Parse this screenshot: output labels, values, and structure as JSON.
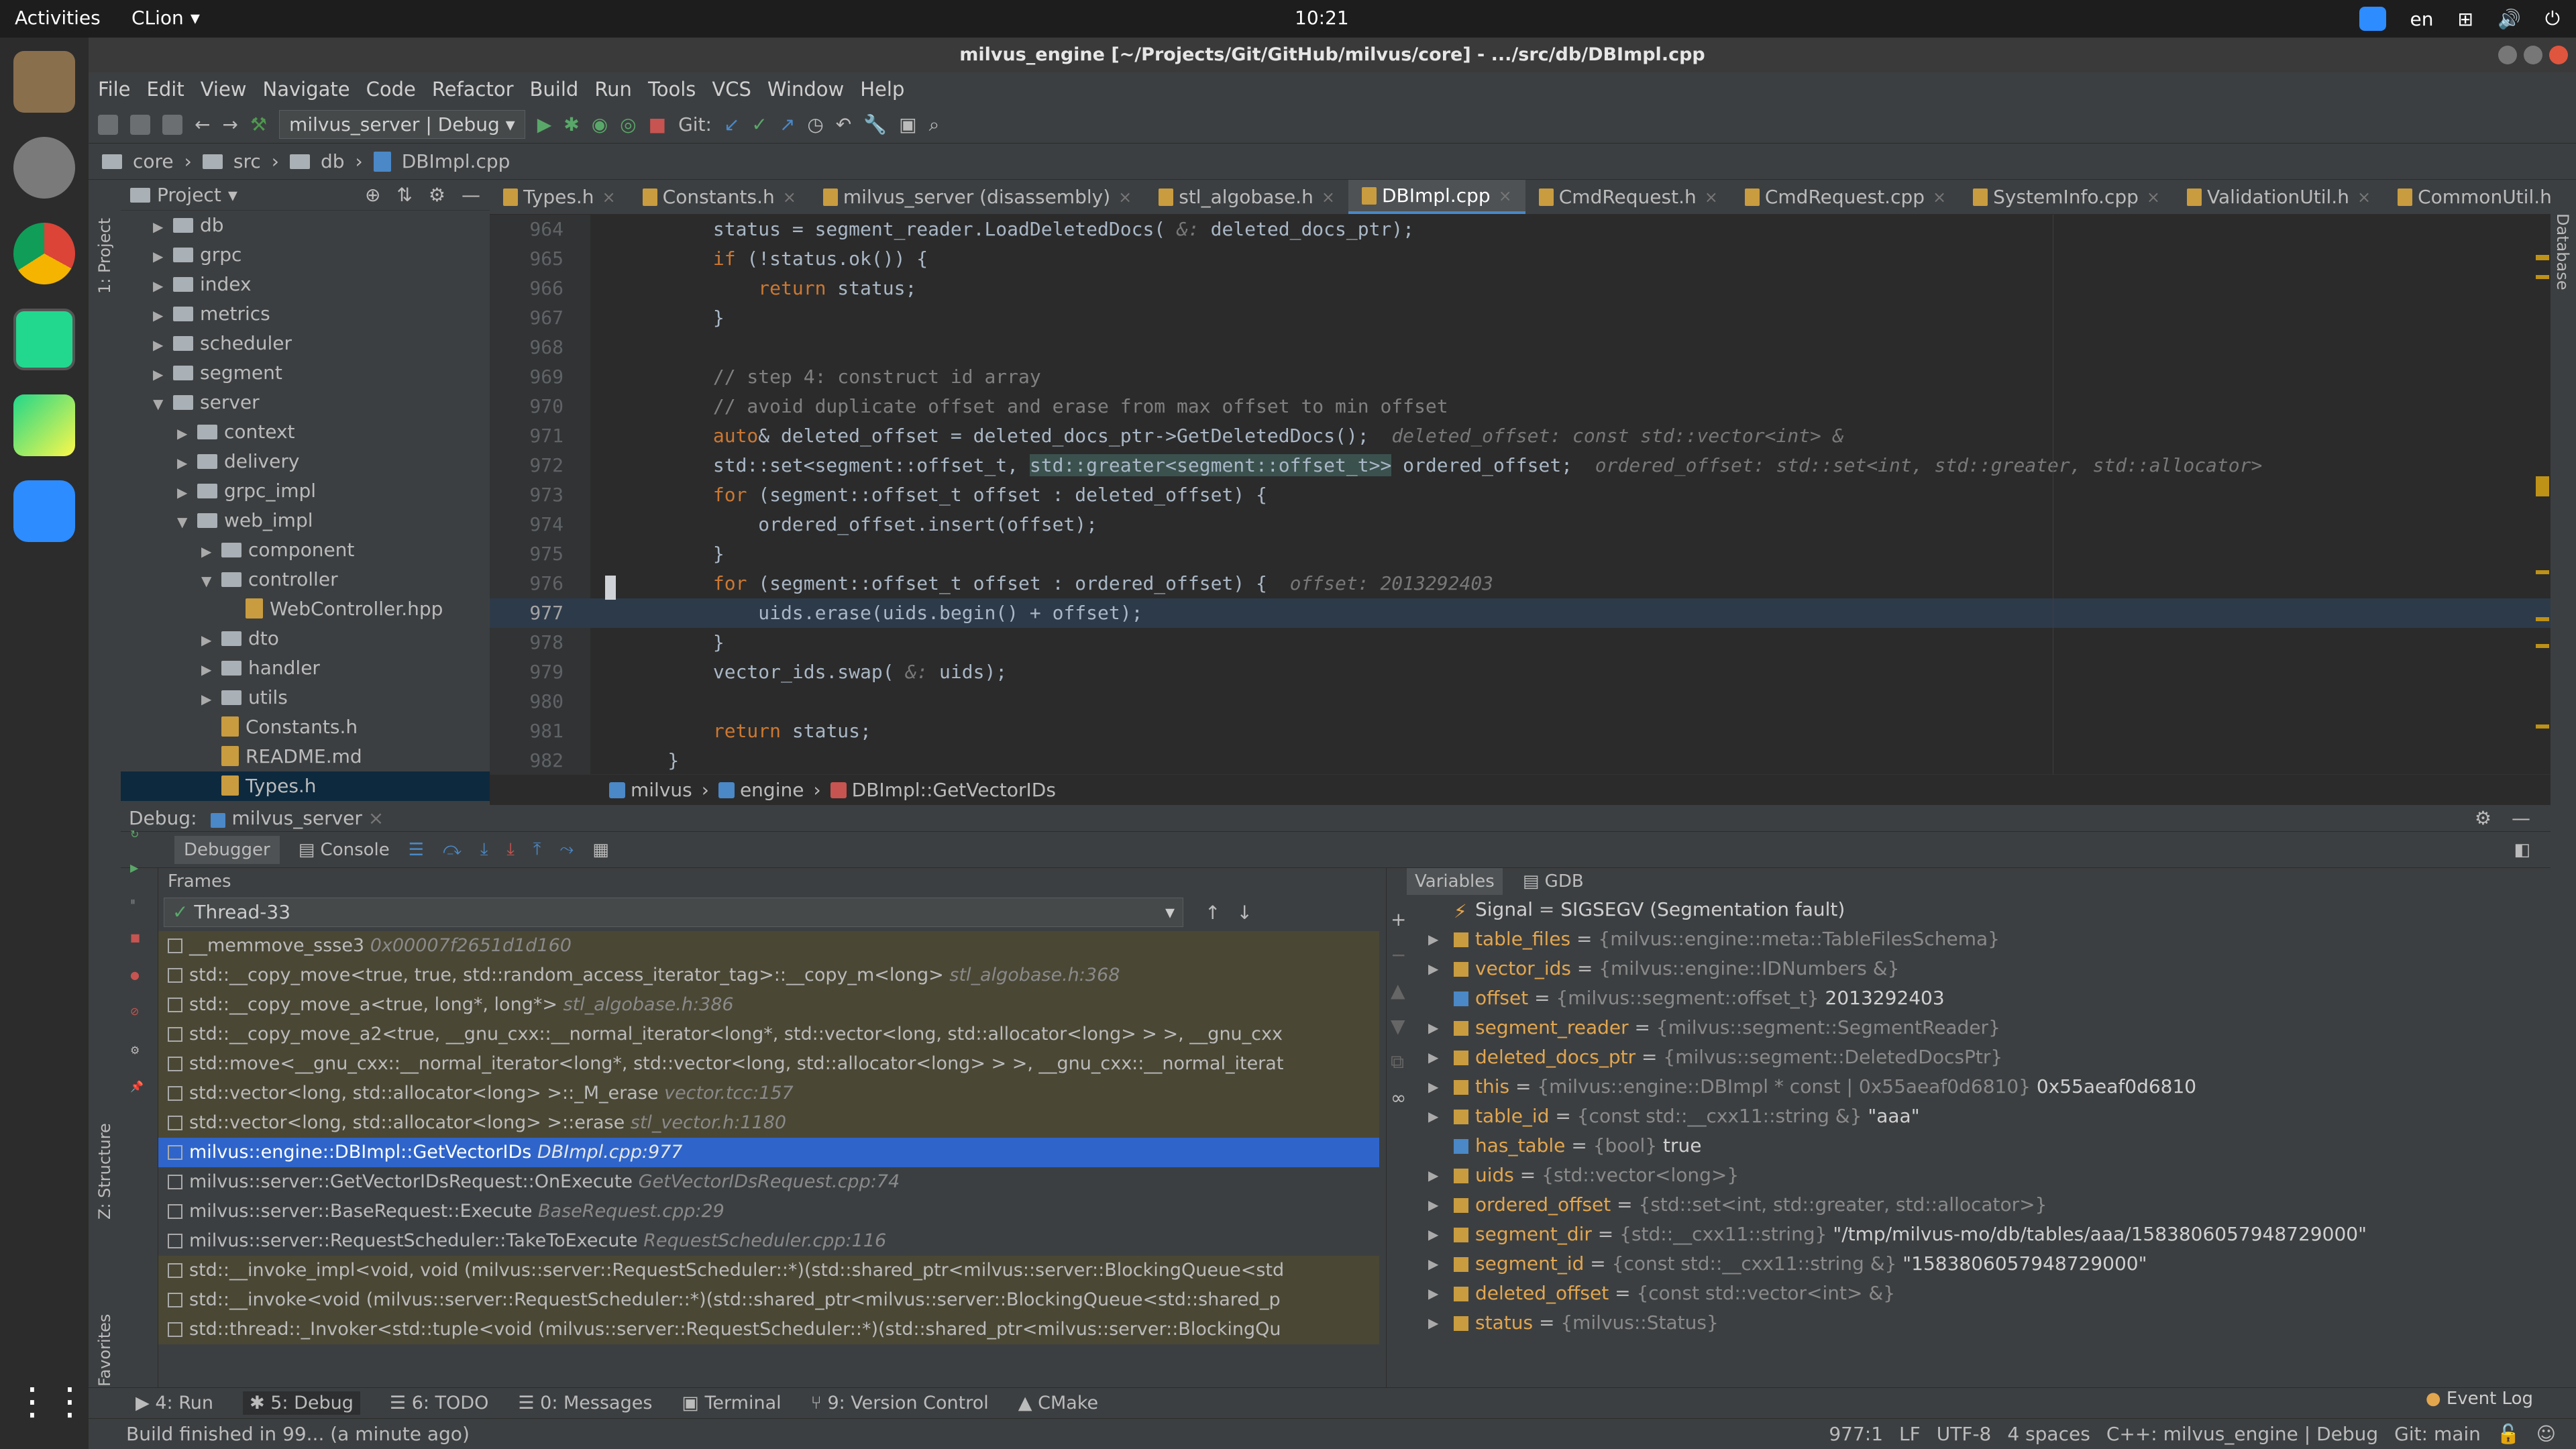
{
  "topbar": {
    "activities": "Activities",
    "app": "CLion",
    "clock": "10:21",
    "lang": "en"
  },
  "window": {
    "title": "milvus_engine [~/Projects/Git/GitHub/milvus/core] - .../src/db/DBImpl.cpp"
  },
  "menu": [
    "File",
    "Edit",
    "View",
    "Navigate",
    "Code",
    "Refactor",
    "Build",
    "Run",
    "Tools",
    "VCS",
    "Window",
    "Help"
  ],
  "toolbar": {
    "run_config": "milvus_server | Debug",
    "git_label": "Git:"
  },
  "navbar": [
    "core",
    "src",
    "db",
    "DBImpl.cpp"
  ],
  "project": {
    "title": "Project",
    "strip_label": "1: Project",
    "tree": [
      {
        "label": "db",
        "indent": 1,
        "type": "folder",
        "open": false
      },
      {
        "label": "grpc",
        "indent": 1,
        "type": "folder",
        "open": false
      },
      {
        "label": "index",
        "indent": 1,
        "type": "folder",
        "open": false
      },
      {
        "label": "metrics",
        "indent": 1,
        "type": "folder",
        "open": false
      },
      {
        "label": "scheduler",
        "indent": 1,
        "type": "folder",
        "open": false
      },
      {
        "label": "segment",
        "indent": 1,
        "type": "folder",
        "open": false
      },
      {
        "label": "server",
        "indent": 1,
        "type": "folder",
        "open": true
      },
      {
        "label": "context",
        "indent": 2,
        "type": "folder",
        "open": false
      },
      {
        "label": "delivery",
        "indent": 2,
        "type": "folder",
        "open": false
      },
      {
        "label": "grpc_impl",
        "indent": 2,
        "type": "folder",
        "open": false
      },
      {
        "label": "web_impl",
        "indent": 2,
        "type": "folder",
        "open": true
      },
      {
        "label": "component",
        "indent": 3,
        "type": "folder",
        "open": false
      },
      {
        "label": "controller",
        "indent": 3,
        "type": "folder",
        "open": true
      },
      {
        "label": "WebController.hpp",
        "indent": 4,
        "type": "file"
      },
      {
        "label": "dto",
        "indent": 3,
        "type": "folder",
        "open": false
      },
      {
        "label": "handler",
        "indent": 3,
        "type": "folder",
        "open": false
      },
      {
        "label": "utils",
        "indent": 3,
        "type": "folder",
        "open": false
      },
      {
        "label": "Constants.h",
        "indent": 3,
        "type": "file"
      },
      {
        "label": "README.md",
        "indent": 3,
        "type": "file"
      },
      {
        "label": "Types.h",
        "indent": 3,
        "type": "file",
        "selected": true
      }
    ]
  },
  "editor": {
    "tabs": [
      "Types.h",
      "Constants.h",
      "milvus_server (disassembly)",
      "stl_algobase.h",
      "DBImpl.cpp",
      "CmdRequest.h",
      "CmdRequest.cpp",
      "SystemInfo.cpp",
      "ValidationUtil.h",
      "CommonUtil.h"
    ],
    "active_tab": "DBImpl.cpp",
    "lines": [
      {
        "n": "964",
        "html": "        status = segment_reader.LoadDeletedDocs( <span class=\"hint\">&amp;:</span> deleted_docs_ptr);"
      },
      {
        "n": "965",
        "html": "        <span class=\"kw\">if</span> (!status.ok()) {"
      },
      {
        "n": "966",
        "html": "            <span class=\"kw\">return</span> status;"
      },
      {
        "n": "967",
        "html": "        }"
      },
      {
        "n": "968",
        "html": ""
      },
      {
        "n": "969",
        "html": "        <span class=\"cm\">// step 4: construct id array</span>"
      },
      {
        "n": "970",
        "html": "        <span class=\"cm\">// avoid duplicate offset and erase from max offset to min offset</span>"
      },
      {
        "n": "971",
        "html": "        <span class=\"kw\">auto</span>&amp; deleted_offset = deleted_docs_ptr-&gt;GetDeletedDocs();  <span class=\"hint\">deleted_offset: const std::vector&lt;int&gt; &amp;</span>"
      },
      {
        "n": "972",
        "html": "        std::set&lt;segment::offset_t, <span class=\"hl\">std::greater&lt;segment::offset_t&gt;&gt;</span> ordered_offset;  <span class=\"hint\">ordered_offset: std::set&lt;int, std::greater, std::allocator&gt;</span>"
      },
      {
        "n": "973",
        "html": "        <span class=\"kw\">for</span> (segment::offset_t offset : deleted_offset) {"
      },
      {
        "n": "974",
        "html": "            ordered_offset.insert(offset);"
      },
      {
        "n": "975",
        "html": "        }"
      },
      {
        "n": "976",
        "html": "        <span class=\"kw\">for</span> (segment::offset_t offset : ordered_offset) {  <span class=\"hint\">offset: 2013292403</span>"
      },
      {
        "n": "977",
        "html": "            uids.erase(uids.begin() + offset);",
        "current": true
      },
      {
        "n": "978",
        "html": "        }"
      },
      {
        "n": "979",
        "html": "        vector_ids.swap( <span class=\"hint\">&amp;:</span> uids);"
      },
      {
        "n": "980",
        "html": ""
      },
      {
        "n": "981",
        "html": "        <span class=\"kw\">return</span> status;"
      },
      {
        "n": "982",
        "html": "    }"
      }
    ],
    "breadcrumbs": [
      "milvus",
      "engine",
      "DBImpl::GetVectorIDs"
    ]
  },
  "debug": {
    "label": "Debug:",
    "session": "milvus_server",
    "tabs": [
      "Debugger",
      "Console"
    ],
    "frames_title": "Frames",
    "thread": "Thread-33",
    "frames": [
      {
        "fn": "__memmove_ssse3",
        "loc": "0x00007f2651d1d160",
        "kind": "lib"
      },
      {
        "fn": "std::__copy_move<true, true, std::random_access_iterator_tag>::__copy_m<long>",
        "loc": "stl_algobase.h:368",
        "kind": "lib"
      },
      {
        "fn": "std::__copy_move_a<true, long*, long*>",
        "loc": "stl_algobase.h:386",
        "kind": "lib"
      },
      {
        "fn": "std::__copy_move_a2<true, __gnu_cxx::__normal_iterator<long*, std::vector<long, std::allocator<long> > >, __gnu_cxx",
        "loc": "",
        "kind": "lib"
      },
      {
        "fn": "std::move<__gnu_cxx::__normal_iterator<long*, std::vector<long, std::allocator<long> > >, __gnu_cxx::__normal_iterat",
        "loc": "",
        "kind": "lib"
      },
      {
        "fn": "std::vector<long, std::allocator<long> >::_M_erase",
        "loc": "vector.tcc:157",
        "kind": "lib"
      },
      {
        "fn": "std::vector<long, std::allocator<long> >::erase",
        "loc": "stl_vector.h:1180",
        "kind": "lib"
      },
      {
        "fn": "milvus::engine::DBImpl::GetVectorIDs",
        "loc": "DBImpl.cpp:977",
        "kind": "sel"
      },
      {
        "fn": "milvus::server::GetVectorIDsRequest::OnExecute",
        "loc": "GetVectorIDsRequest.cpp:74",
        "kind": ""
      },
      {
        "fn": "milvus::server::BaseRequest::Execute",
        "loc": "BaseRequest.cpp:29",
        "kind": ""
      },
      {
        "fn": "milvus::server::RequestScheduler::TakeToExecute",
        "loc": "RequestScheduler.cpp:116",
        "kind": ""
      },
      {
        "fn": "std::__invoke_impl<void, void (milvus::server::RequestScheduler::*)(std::shared_ptr<milvus::server::BlockingQueue<std",
        "loc": "",
        "kind": "lib"
      },
      {
        "fn": "std::__invoke<void (milvus::server::RequestScheduler::*)(std::shared_ptr<milvus::server::BlockingQueue<std::shared_p",
        "loc": "",
        "kind": "lib"
      },
      {
        "fn": "std::thread::_Invoker<std::tuple<void (milvus::server::RequestScheduler::*)(std::shared_ptr<milvus::server::BlockingQu",
        "loc": "",
        "kind": "lib"
      }
    ],
    "var_tabs": [
      "Variables",
      "GDB"
    ],
    "variables": [
      {
        "name": "Signal",
        "type": "",
        "value": "SIGSEGV (Segmentation fault)",
        "exp": false,
        "signal": true
      },
      {
        "name": "table_files",
        "type": "{milvus::engine::meta::TableFilesSchema}",
        "value": "",
        "exp": true
      },
      {
        "name": "vector_ids",
        "type": "{milvus::engine::IDNumbers &}",
        "value": "",
        "exp": true
      },
      {
        "name": "offset",
        "type": "{milvus::segment::offset_t}",
        "value": "2013292403",
        "exp": false
      },
      {
        "name": "segment_reader",
        "type": "{milvus::segment::SegmentReader}",
        "value": "",
        "exp": true
      },
      {
        "name": "deleted_docs_ptr",
        "type": "{milvus::segment::DeletedDocsPtr}",
        "value": "",
        "exp": true
      },
      {
        "name": "this",
        "type": "{milvus::engine::DBImpl * const | 0x55aeaf0d6810}",
        "value": "0x55aeaf0d6810",
        "exp": true
      },
      {
        "name": "table_id",
        "type": "{const std::__cxx11::string &}",
        "value": "\"aaa\"",
        "exp": true
      },
      {
        "name": "has_table",
        "type": "{bool}",
        "value": "true",
        "exp": false
      },
      {
        "name": "uids",
        "type": "{std::vector<long>}",
        "value": "",
        "exp": true
      },
      {
        "name": "ordered_offset",
        "type": "{std::set<int, std::greater, std::allocator>}",
        "value": "",
        "exp": true
      },
      {
        "name": "segment_dir",
        "type": "{std::__cxx11::string}",
        "value": "\"/tmp/milvus-mo/db/tables/aaa/1583806057948729000\"",
        "exp": true
      },
      {
        "name": "segment_id",
        "type": "{const std::__cxx11::string &}",
        "value": "\"1583806057948729000\"",
        "exp": true
      },
      {
        "name": "deleted_offset",
        "type": "{const std::vector<int> &}",
        "value": "",
        "exp": true
      },
      {
        "name": "status",
        "type": "{milvus::Status}",
        "value": "",
        "exp": true
      }
    ]
  },
  "side_labels": {
    "structure": "Z: Structure",
    "favorites": "2: Favorites",
    "database": "Database"
  },
  "bottom_tools": [
    "4: Run",
    "5: Debug",
    "6: TODO",
    "0: Messages",
    "Terminal",
    "9: Version Control",
    "CMake"
  ],
  "event_log": "Event Log",
  "status": {
    "message": "Build finished in 99... (a minute ago)",
    "items": [
      "977:1",
      "LF",
      "UTF-8",
      "4 spaces",
      "C++: milvus_engine | Debug",
      "Git: main"
    ]
  }
}
